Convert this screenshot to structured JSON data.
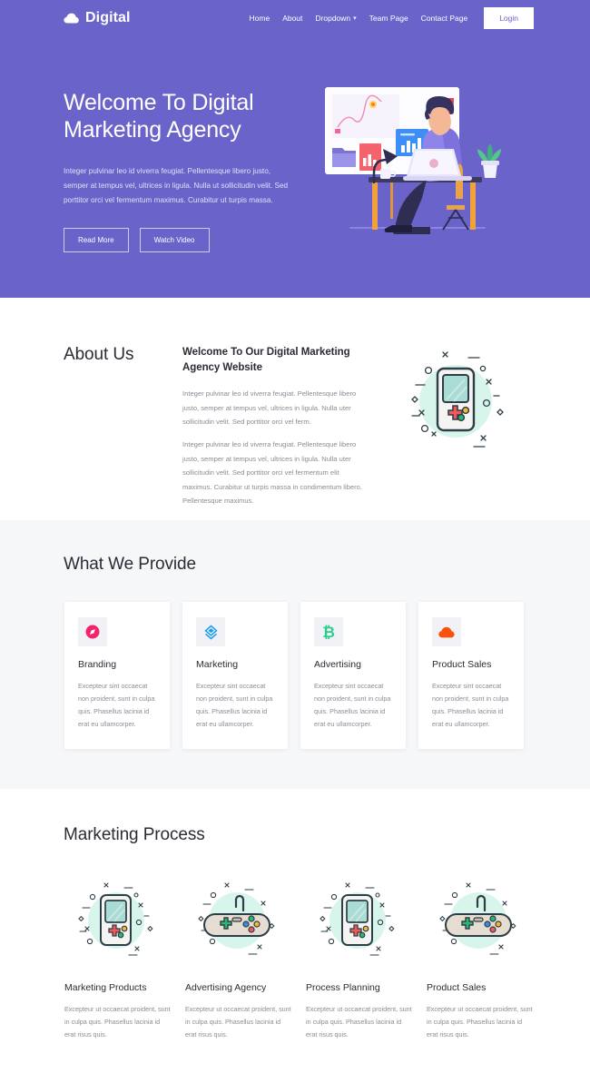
{
  "nav": {
    "brand": "Digital",
    "brand_icon": "cloud-icon",
    "links": [
      {
        "label": "Home"
      },
      {
        "label": "About"
      },
      {
        "label": "Dropdown",
        "caret": "⌄"
      },
      {
        "label": "Team Page"
      },
      {
        "label": "Contact Page"
      }
    ],
    "login_label": "Login"
  },
  "hero": {
    "title_line1": "Welcome To Digital",
    "title_line2": "Marketing Agency",
    "paragraph": "Integer pulvinar leo id viverra feugiat. Pellentesque libero justo, semper at tempus vel, ultrices in ligula. Nulla ut sollicitudin velit. Sed porttitor orci vel fermentum maximus. Curabitur ut turpis massa.",
    "button_primary": "Read More",
    "button_secondary": "Watch Video",
    "illustration": "man-working-at-desk-illustration"
  },
  "about": {
    "heading": "About Us",
    "subheading": "Welcome To Our Digital Marketing Agency Website",
    "paragraph1": "Integer pulvinar leo id viverra feugiat. Pellentesque libero justo, semper at tempus vel, ultrices in ligula. Nulla uter sollicitudin velit. Sed porttitor orci vel ferm.",
    "paragraph2": "Integer pulvinar leo id viverra feugiat. Pellentesque libero justo, semper at tempus vel, ultrices in ligula. Nulla uter sollicitudin velit. Sed porttitor orci vel fermentum elit maximus. Curabitur ut turpis massa in condimentum libero. Pellentesque maximus.",
    "illustration": "handheld-game-console-illustration"
  },
  "provide": {
    "heading": "What We Provide",
    "cards": [
      {
        "icon": "compass-icon",
        "icon_color": "#f5236a",
        "title": "Branding",
        "text": "Excepteur sint occaecat non proident, sunt in culpa quis. Phasellus lacinia id erat eu ullamcorper."
      },
      {
        "icon": "diamond-network-icon",
        "icon_color": "#1d9bf0",
        "title": "Marketing",
        "text": "Excepteur sint occaecat non proident, sunt in culpa quis. Phasellus lacinia id erat eu ullamcorper."
      },
      {
        "icon": "bitcoin-icon",
        "icon_color": "#2ecc8f",
        "icon_glyph": "₿",
        "title": "Advertising",
        "text": "Excepteur sint occaecat non proident, sunt in culpa quis. Phasellus lacinia id erat eu ullamcorper."
      },
      {
        "icon": "cloud-icon",
        "icon_color": "#f9520f",
        "title": "Product Sales",
        "text": "Excepteur sint occaecat non proident, sunt in culpa quis. Phasellus lacinia id erat eu ullamcorper."
      }
    ]
  },
  "process": {
    "heading": "Marketing Process",
    "items": [
      {
        "illustration": "handheld-game-console-illustration",
        "title": "Marketing Products",
        "text": "Excepteur ut occaecat proident, sunt in culpa quis. Phasellus lacinia id erat risus quis."
      },
      {
        "illustration": "gamepad-controller-illustration",
        "title": "Advertising Agency",
        "text": "Excepteur ut occaecat proident, sunt in culpa quis. Phasellus lacinia id erat risus quis."
      },
      {
        "illustration": "handheld-game-console-illustration",
        "title": "Process Planning",
        "text": "Excepteur ut occaecat proident, sunt in culpa quis. Phasellus lacinia id erat risus quis."
      },
      {
        "illustration": "gamepad-controller-illustration",
        "title": "Product Sales",
        "text": "Excepteur ut occaecat proident, sunt in culpa quis. Phasellus lacinia id erat risus quis."
      }
    ]
  },
  "colors": {
    "brand_purple": "#6a64ca",
    "section_gray": "#f6f7f9",
    "text_dark": "#2b2b35",
    "text_muted": "#8b8b96",
    "mint": "#d8f5ec"
  }
}
